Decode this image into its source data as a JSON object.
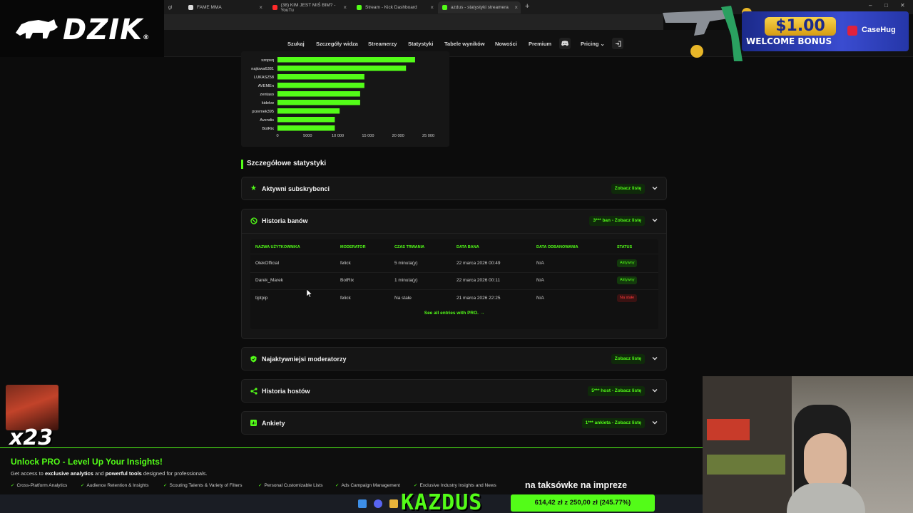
{
  "browser": {
    "tabs": [
      {
        "title": "gl",
        "active": false
      },
      {
        "title": "FAME MMA",
        "active": false
      },
      {
        "title": "(38) KIM JEST MIŚ BIM? - YouTu",
        "active": false
      },
      {
        "title": "Stream - Kick Dashboard",
        "active": false
      },
      {
        "title": "azdus - statystyki streamera",
        "active": true
      }
    ],
    "new_tab": "+",
    "win_min": "–",
    "win_max": "□",
    "win_close": "✕"
  },
  "logo": {
    "text": "DZIK",
    "mark": "®"
  },
  "nav": {
    "items": [
      "Szukaj",
      "Szczegóły widza",
      "Streamerzy",
      "Statystyki",
      "Tabele wyników",
      "Nowości",
      "Premium",
      "Pricing"
    ],
    "pricing_caret": "⌄"
  },
  "promo": {
    "amount": "$1.00",
    "label": "WELCOME BONUS",
    "brand": "CaseHug"
  },
  "chart_data": {
    "type": "bar",
    "orientation": "horizontal",
    "categories": [
      "szopsq",
      "najtowa6381",
      "LUKASZ58",
      "AVEMEn",
      "zentaso",
      "kidekw",
      "przemek395",
      "Avendis",
      "BotRix"
    ],
    "values": [
      22800,
      21300,
      14400,
      14400,
      13700,
      13700,
      10300,
      9500,
      9500
    ],
    "xlim": [
      0,
      26000
    ],
    "xticks": [
      0,
      5000,
      10000,
      15000,
      20000,
      25000
    ],
    "xtick_labels": [
      "0",
      "5000",
      "10 000",
      "15 000",
      "20 000",
      "25 000"
    ],
    "title": "",
    "xlabel": "",
    "ylabel": "",
    "color": "#53fc18"
  },
  "details": {
    "title": "Szczegółowe statystyki",
    "sections": [
      {
        "title": "Aktywni subskrybenci",
        "badge": "Zobacz listę",
        "icon": "star-icon"
      },
      {
        "title": "Historia banów",
        "badge": "3*** ban - Zobacz listę",
        "icon": "ban-icon"
      },
      {
        "title": "Najaktywniejsi moderatorzy",
        "badge": "Zobacz listę",
        "icon": "shield-icon"
      },
      {
        "title": "Historia hostów",
        "badge": "5*** host - Zobacz listę",
        "icon": "share-icon"
      },
      {
        "title": "Ankiety",
        "badge": "1*** ankieta - Zobacz listę",
        "icon": "poll-icon"
      }
    ],
    "ban_table": {
      "headers": [
        "NAZWA UŻYTKOWNIKA",
        "MODERATOR",
        "CZAS TRWANIA",
        "DATA BANA",
        "DATA ODBANOWANIA",
        "STATUS"
      ],
      "rows": [
        {
          "user": "OlekOfficial",
          "moderator": "felick",
          "duration": "5 minuta(y)",
          "ban_date": "22 marca 2026 00:49",
          "unban_date": "N/A",
          "status": "Aktywny",
          "status_kind": "active"
        },
        {
          "user": "Darek_Marek",
          "moderator": "BotRix",
          "duration": "1 minuta(y)",
          "ban_date": "22 marca 2026 00:11",
          "unban_date": "N/A",
          "status": "Aktywny",
          "status_kind": "active"
        },
        {
          "user": "tiptpip",
          "moderator": "felick",
          "duration": "Na stałe",
          "ban_date": "21 marca 2026 22:25",
          "unban_date": "N/A",
          "status": "Na stałe",
          "status_kind": "permanent"
        }
      ],
      "see_all": "See all entries with PRO. →"
    }
  },
  "pro_banner": {
    "title": "Unlock PRO - Level Up Your Insights!",
    "sub_pre": "Get access to ",
    "sub_b1": "exclusive analytics",
    "sub_mid": " and ",
    "sub_b2": "powerful tools",
    "sub_post": " designed for professionals.",
    "features": [
      "Cross-Platform Analytics",
      "Audience Retention & Insights",
      "Scouting Talents & Variety of Filters",
      "Personal Customizable Lists",
      "Ads Campaign Management",
      "Exclusive Industry Insights and News"
    ]
  },
  "overlay": {
    "multiplier": "x23",
    "channel": "KAZDUS",
    "caption": "na taksówke na impreze",
    "goal_text": "614,42 zł z 250,00 zł (245.77%)",
    "goal_fraction": 1.0
  },
  "colors": {
    "accent": "#53fc18",
    "danger": "#ff3b3b",
    "background": "#0c0c0c"
  }
}
